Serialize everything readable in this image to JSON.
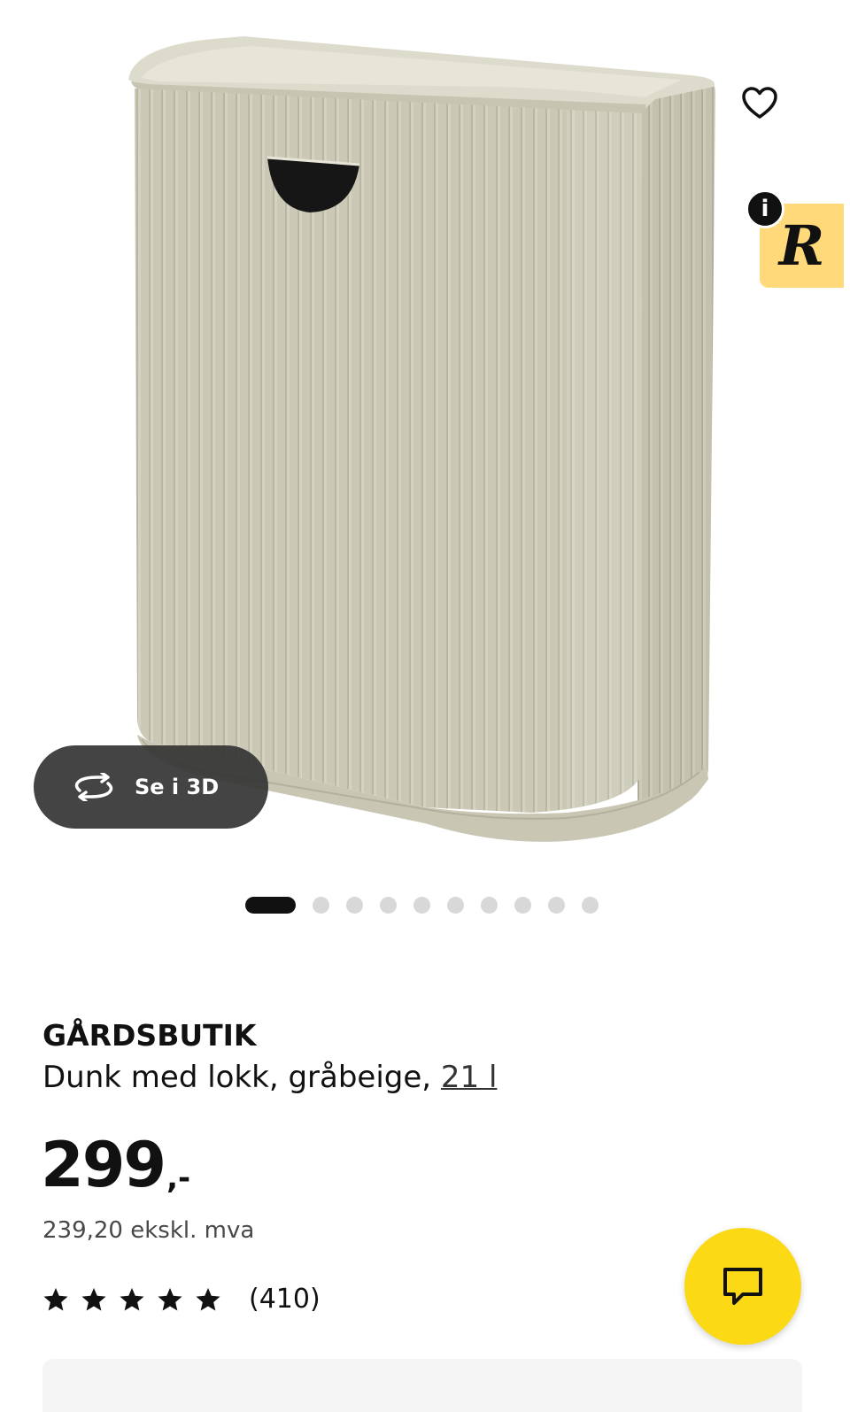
{
  "gallery": {
    "view_3d_label": "Se i 3D",
    "dots_total": 10,
    "active_index": 0
  },
  "overlay": {
    "info_label": "i",
    "badge_letter": "R"
  },
  "product": {
    "brand": "GÅRDSBUTIK",
    "description": "Dunk med lokk, gråbeige, ",
    "size": "21 l",
    "price_integer": "299",
    "price_suffix": ",-",
    "price_ex_vat": "239,20 ekskl. mva",
    "rating_stars": 5,
    "review_count": "(410)"
  },
  "colors": {
    "product_body": "#cbc9b6",
    "chat_button": "#fbd914",
    "badge": "#ffd97a"
  },
  "icons": {
    "wishlist": "heart-outline-icon",
    "view_3d": "rotate-3d-icon",
    "chat": "chat-bubble-icon",
    "star": "star-filled-icon"
  }
}
